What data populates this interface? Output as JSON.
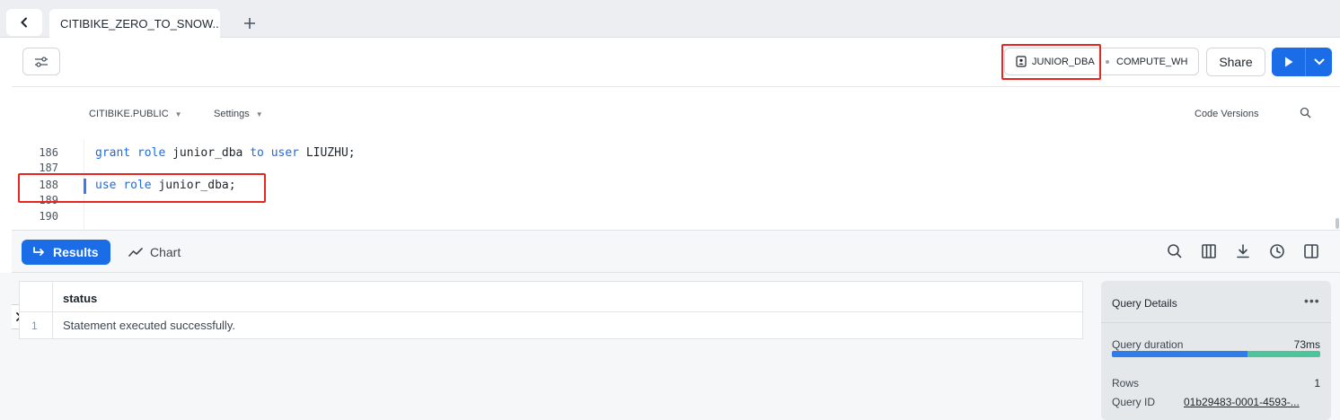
{
  "tabs": {
    "active_label": "CITIBIKE_ZERO_TO_SNOW...",
    "add_label": "+"
  },
  "toolbar": {
    "role": "JUNIOR_DBA",
    "warehouse": "COMPUTE_WH",
    "share_label": "Share"
  },
  "editor": {
    "database": "CITIBIKE.PUBLIC",
    "settings_label": "Settings",
    "code_versions_label": "Code Versions",
    "line_numbers": [
      "186",
      "187",
      "188",
      "189",
      "190"
    ],
    "lines": {
      "l186": {
        "kw1": "grant",
        "kw2": "role",
        "t1": " junior_dba ",
        "kw3": "to",
        "kw4": "user",
        "t2": " LIUZHU;"
      },
      "l188": {
        "kw1": "use",
        "kw2": "role",
        "t1": " junior_dba;"
      }
    }
  },
  "results": {
    "results_label": "Results",
    "chart_label": "Chart",
    "columns": [
      "status"
    ],
    "rows": [
      {
        "index": "1",
        "status": "Statement executed successfully."
      }
    ]
  },
  "query_details": {
    "title": "Query Details",
    "more": "•••",
    "duration_label": "Query duration",
    "duration_value": "73ms",
    "duration_split": 0.65,
    "rows_label": "Rows",
    "rows_value": "1",
    "query_id_label": "Query ID",
    "query_id_value": "01b29483-0001-4593-..."
  },
  "colors": {
    "accent": "#1a6ce7",
    "highlight": "#e8261f",
    "bar_secondary": "#4dc59b"
  },
  "icons": [
    "chevron-left-icon",
    "plus-icon",
    "sliders-icon",
    "role-badge-icon",
    "play-icon",
    "chevron-down-icon",
    "search-icon",
    "return-arrow-icon",
    "line-chart-icon",
    "columns-icon",
    "download-icon",
    "clock-icon",
    "panel-icon",
    "chevron-right-icon"
  ]
}
